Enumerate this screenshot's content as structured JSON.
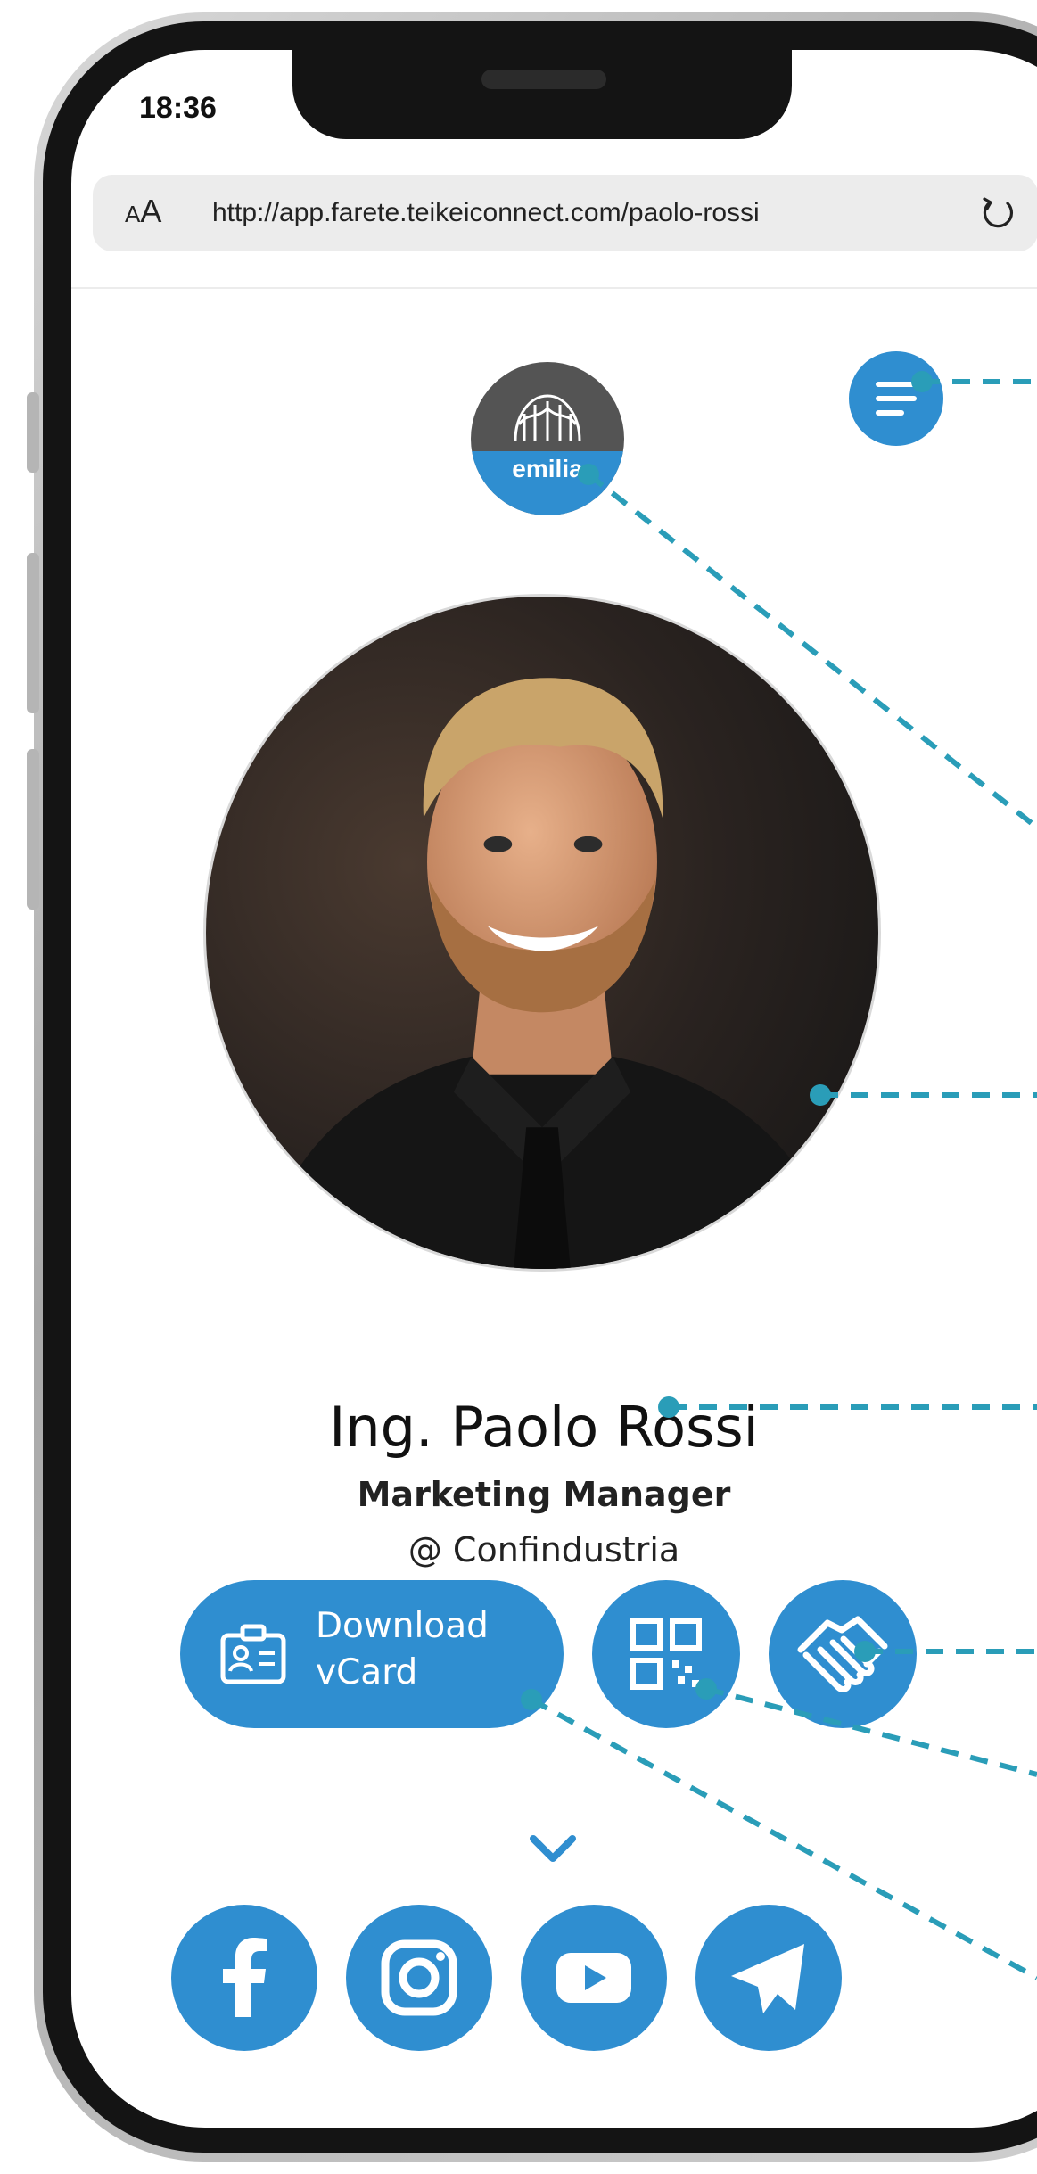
{
  "status_bar": {
    "time": "18:36"
  },
  "browser": {
    "aa_small": "A",
    "aa_large": "A",
    "url": "http://app.farete.teikeiconnect.com/paolo-rossi"
  },
  "header": {
    "logo_text": "emilia"
  },
  "profile": {
    "name": "Ing. Paolo Rossi",
    "role": "Marketing Manager",
    "company": "@ Confindustria"
  },
  "actions": {
    "vcard_line1": "Download",
    "vcard_line2": "vCard"
  },
  "icons": {
    "menu": "menu-icon",
    "vcard": "contact-card-icon",
    "qr": "qr-code-icon",
    "partner": "handshake-icon",
    "expand": "chevron-down-icon",
    "social": [
      "facebook-icon",
      "instagram-icon",
      "youtube-icon",
      "telegram-icon"
    ]
  },
  "colors": {
    "accent": "#2f8ed0",
    "callout_line": "#2a9db8"
  }
}
